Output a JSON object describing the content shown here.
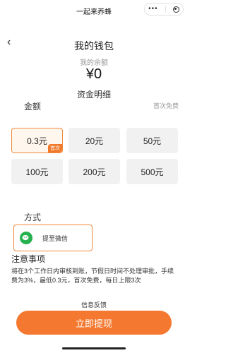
{
  "topbar": {
    "title": "一起来养蜂",
    "capsule_more": "•••"
  },
  "header": {
    "back": "‹",
    "title": "我的钱包"
  },
  "balance": {
    "label": "我的余额",
    "value": "¥0",
    "details": "资金明细"
  },
  "withdraw": {
    "amount_label": "金额",
    "first_free": "首次免费",
    "amounts": [
      "0.3元",
      "20元",
      "50元",
      "100元",
      "200元",
      "500元"
    ],
    "selected_badge": "首次"
  },
  "method": {
    "label": "方式",
    "option": "提至微信"
  },
  "notes": {
    "title": "注意事项",
    "text": "将在3个工作日内审核到账，节假日时间不处理审批，手续费为3%，最低0.3元，首次免费，每日上限3次"
  },
  "footer": {
    "feedback": "信息反馈",
    "submit": "立即提现"
  },
  "colors": {
    "accent": "#f4782f",
    "wechat_green": "#27b04f"
  }
}
